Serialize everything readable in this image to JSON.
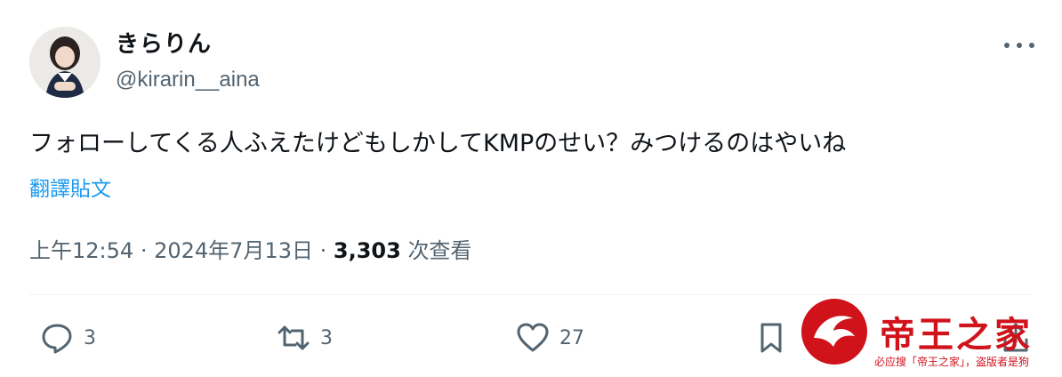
{
  "user": {
    "display_name": "きらりん",
    "handle": "@kirarin__aina",
    "avatar_icon": "user-avatar-photo"
  },
  "tweet": {
    "text": "フォローしてくる人ふえたけどもしかしてKMPのせい？みつけるのはやいね",
    "translate_label": "翻譯貼文",
    "time": "上午12:54",
    "date": "2024年7月13日",
    "views_count": "3,303",
    "views_label": "次查看"
  },
  "actions": {
    "reply_count": "3",
    "retweet_count": "3",
    "like_count": "27"
  },
  "watermark": {
    "title": "帝王之家",
    "subtitle": "必应搜「帝王之家」，盗版者是狗"
  },
  "colors": {
    "link": "#1d9bf0",
    "secondary_text": "#536471",
    "watermark_red": "#d0121b"
  }
}
